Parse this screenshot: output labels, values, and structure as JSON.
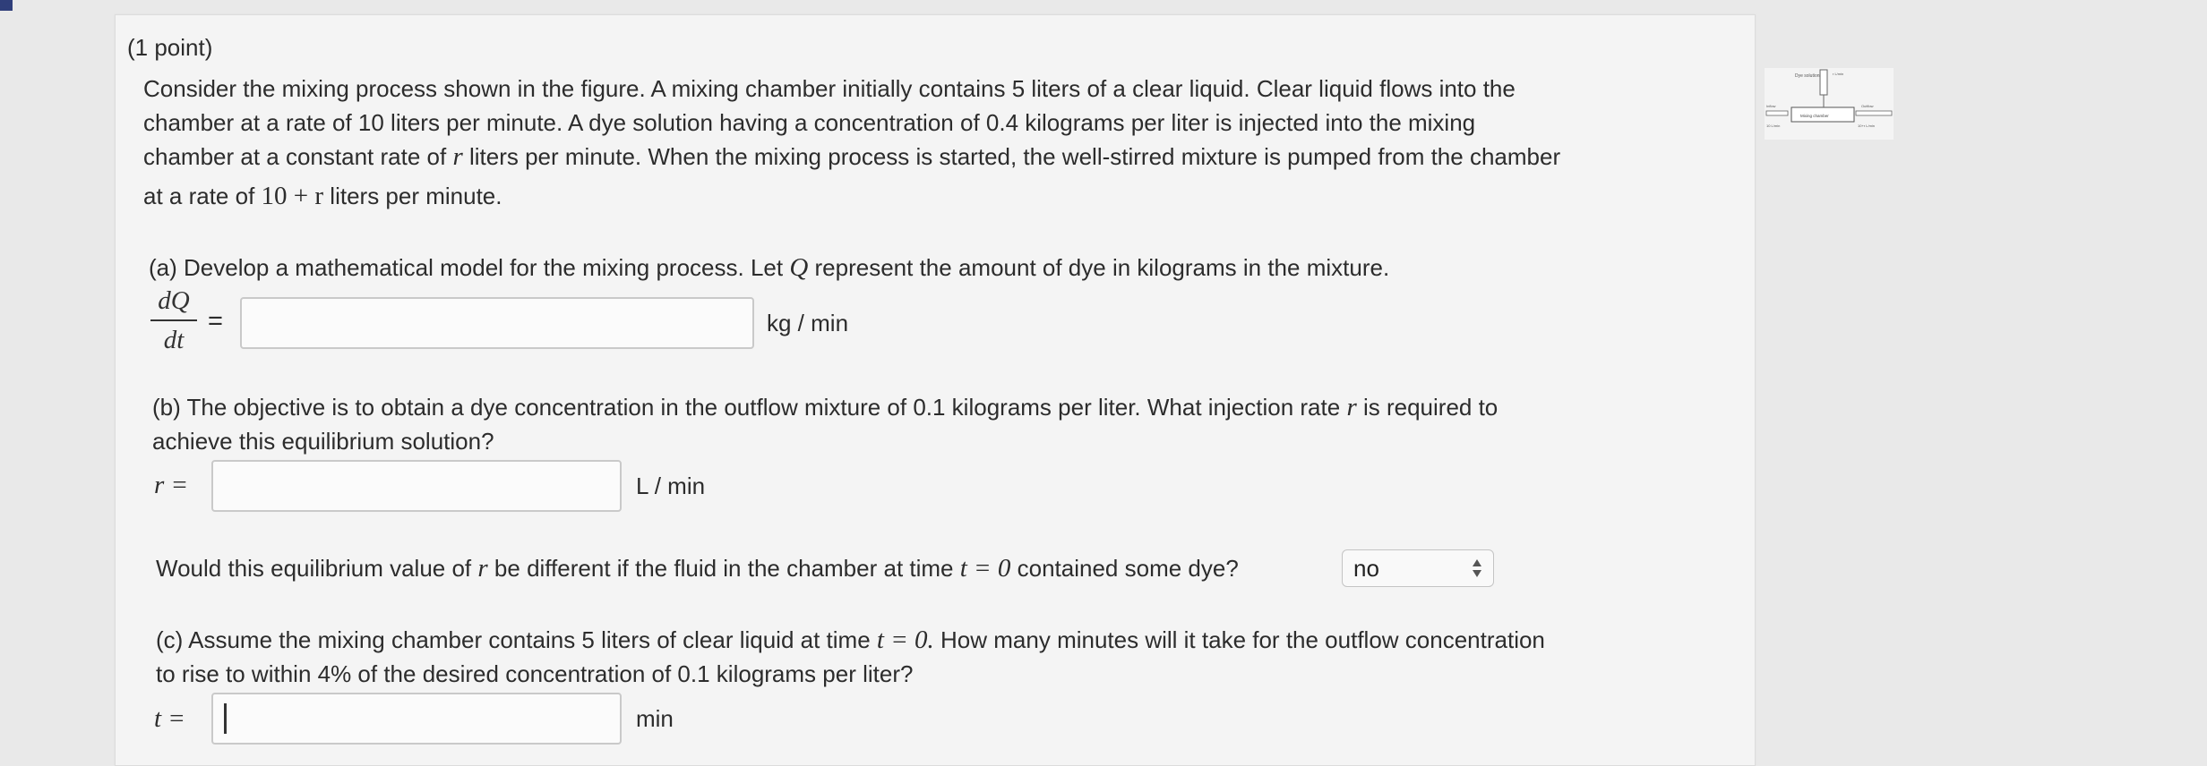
{
  "problem": {
    "points": "(1 point)",
    "intro": [
      "Consider the mixing process shown in the figure. A mixing chamber initially contains 5 liters of a clear liquid. Clear liquid flows into the",
      "chamber at a rate of 10 liters per minute. A dye solution having a concentration of 0.4 kilograms per liter is injected into the mixing",
      "chamber at a constant rate of",
      "liters per minute. When the mixing process is started, the well-stirred mixture is pumped from the chamber",
      "at a rate of",
      "liters per minute."
    ],
    "var_r": "r",
    "rate_expr": "10 + r"
  },
  "part_a": {
    "prompt_before": "(a) Develop a mathematical model for the mixing process. Let",
    "var": "Q",
    "prompt_after": "represent the amount of dye in kilograms in the mixture.",
    "lhs_num": "dQ",
    "lhs_den": "dt",
    "equals": "=",
    "answer_value": "",
    "unit": "kg / min"
  },
  "part_b": {
    "prompt_line1": "(b) The objective is to obtain a dye concentration in the outflow mixture of 0.1 kilograms per liter. What injection rate",
    "prompt_line1_var": "r",
    "prompt_line1_end": "is required to",
    "prompt_line2": "achieve this equilibrium solution?",
    "lhs": "r =",
    "answer_value": "",
    "unit": "L / min",
    "followup_before": "Would this equilibrium value of",
    "followup_var": "r",
    "followup_mid": "be different if the fluid in the chamber at time",
    "followup_eq": "t = 0",
    "followup_after": "contained some dye?",
    "select_value": "no"
  },
  "part_c": {
    "prompt_line1_before": "(c) Assume the mixing chamber contains 5 liters of clear liquid at time",
    "prompt_line1_eq": "t = 0.",
    "prompt_line1_after": "How many minutes will it take for the outflow concentration",
    "prompt_line2": "to rise to within 4% of the desired concentration of 0.1 kilograms per liter?",
    "lhs": "t =",
    "answer_value": "",
    "unit": "min"
  },
  "figure": {
    "labels": [
      "Dye solution",
      "r L/min",
      "Inflow",
      "10 L/min",
      "Mixing chamber",
      "Outflow",
      "10+r L/min"
    ]
  },
  "colors": {
    "page_bg": "#e9e9e9",
    "panel_bg": "#f4f4f4",
    "input_border": "#c9c9c9"
  }
}
